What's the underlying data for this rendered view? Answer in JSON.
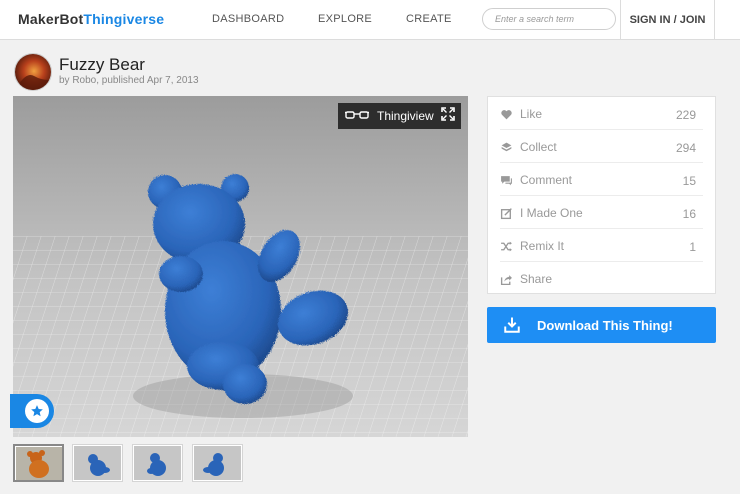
{
  "nav": {
    "logo_prefix": "MakerBot",
    "logo_suffix": "Thingiverse",
    "links": [
      "DASHBOARD",
      "EXPLORE",
      "CREATE"
    ],
    "search_placeholder": "Enter a search term",
    "signin_label": "SIGN IN / JOIN"
  },
  "thing": {
    "title": "Fuzzy Bear",
    "byline": "by Robo, published Apr 7, 2013"
  },
  "viewer": {
    "thingiview_label": "Thingiview",
    "thumbnail_count": 4
  },
  "actions": [
    {
      "label": "Like",
      "count": "229",
      "icon": "heart-icon"
    },
    {
      "label": "Collect",
      "count": "294",
      "icon": "collect-icon"
    },
    {
      "label": "Comment",
      "count": "15",
      "icon": "comment-icon"
    },
    {
      "label": "I Made One",
      "count": "16",
      "icon": "made-icon"
    },
    {
      "label": "Remix It",
      "count": "1",
      "icon": "remix-icon"
    },
    {
      "label": "Share",
      "count": "",
      "icon": "share-icon"
    }
  ],
  "download": {
    "label": "Download This Thing!"
  },
  "colors": {
    "brand_blue": "#1a87e4",
    "download_blue": "#1e8ef4",
    "bear_blue": "#2a64b8"
  }
}
